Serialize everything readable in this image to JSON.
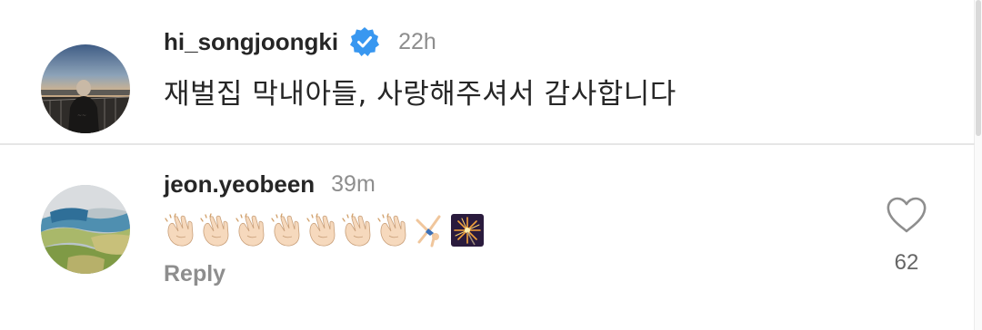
{
  "comments": [
    {
      "username": "hi_songjoongki",
      "verified": true,
      "time": "22h",
      "text": "재벌집 막내아들, 사랑해주셔서 감사합니다"
    },
    {
      "username": "jeon.yeobeen",
      "verified": false,
      "time": "39m",
      "emojis": [
        "clapping-hands",
        "clapping-hands",
        "clapping-hands",
        "clapping-hands",
        "clapping-hands",
        "clapping-hands",
        "clapping-hands",
        "person-cartwheeling",
        "sparkler"
      ],
      "reply_label": "Reply",
      "like_count": "62"
    }
  ],
  "colors": {
    "verified_badge": "#3897f0",
    "secondary_text": "#8e8e8e",
    "primary_text": "#262626"
  }
}
